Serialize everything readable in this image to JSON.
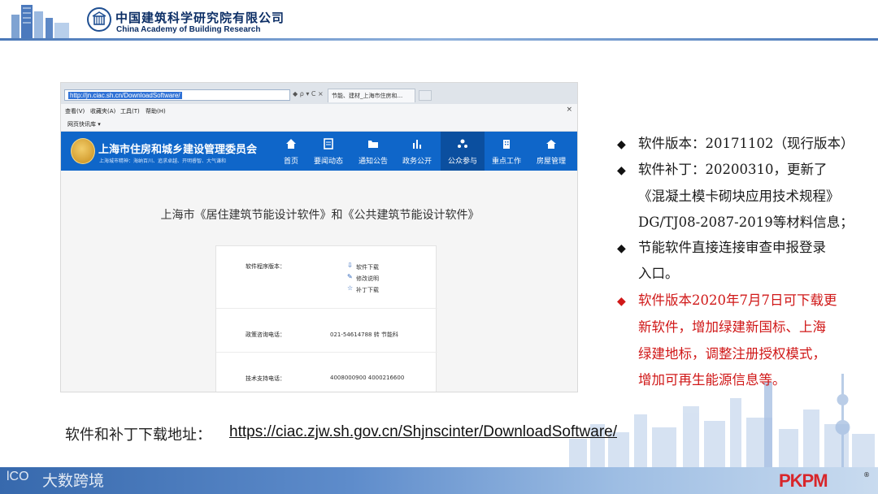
{
  "header": {
    "org_name_cn": "中国建筑科学研究院有限公司",
    "org_name_en": "China Academy of Building Research"
  },
  "browser": {
    "address_url": "http://jn.ciac.sh.cn/DownloadSoftware/",
    "address_controls": "◆ ρ ▾ C ×",
    "tab_title": "节能、建材_上海市住房和...",
    "menu": [
      "查看(V)",
      "收藏夹(A)",
      "工具(T)",
      "帮助(H)"
    ],
    "menu_close": "×",
    "favorites_item": "网页快讯库 ▾"
  },
  "website": {
    "title": "上海市住房和城乡建设管理委员会",
    "slogan": "上海城市精神：海纳百川、追求卓越、开明睿智、大气谦和",
    "nav": [
      {
        "label": "首页",
        "icon": "home-icon",
        "active": false
      },
      {
        "label": "要闻动态",
        "icon": "news-icon",
        "active": false
      },
      {
        "label": "通知公告",
        "icon": "folder-icon",
        "active": false
      },
      {
        "label": "政务公开",
        "icon": "chart-icon",
        "active": false
      },
      {
        "label": "公众参与",
        "icon": "participation-icon",
        "active": true
      },
      {
        "label": "重点工作",
        "icon": "building-icon",
        "active": false
      },
      {
        "label": "房屋管理",
        "icon": "house-icon",
        "active": false
      }
    ],
    "page_title": "上海市《居住建筑节能设计软件》和《公共建筑节能设计软件》",
    "card": {
      "version_label": "软件程序版本：",
      "links": [
        "软件下载",
        "修改说明",
        "补丁下载"
      ],
      "policy_label": "政策咨询电话：",
      "policy_value": "021-54614788 转 节能科",
      "support_label": "技术支持电话：",
      "support_value": "4008000900 4000216600"
    }
  },
  "bullets": {
    "line1": "软件版本：20171102（现行版本）",
    "line2": "软件补丁：20200310，更新了",
    "line3": "《混凝土模卡砌块应用技术规程》",
    "line4": "DG/TJ08-2087-2019等材料信息；",
    "line5": "节能软件直接连接审查申报登录",
    "line6": "入口。",
    "line7": "软件版本2020年7月7日可下载更",
    "line8": "新软件，增加绿建新国标、上海",
    "line9": "绿建地标，调整注册授权模式，",
    "line10": "增加可再生能源信息等。",
    "marker": "◆"
  },
  "download": {
    "label": "软件和补丁下载地址：",
    "url": "https://ciac.zjw.sh.gov.cn/Shjnscinter/DownloadSoftware/"
  },
  "footer": {
    "watermark_mark": "lCO",
    "watermark_text": "大数跨境",
    "brand": "PKPM",
    "registered": "®"
  },
  "colors": {
    "banner_blue": "#0f66c9",
    "highlight_red": "#d01818",
    "pkpm_red": "#d8262b",
    "pkpm_blue": "#1e57a8"
  }
}
